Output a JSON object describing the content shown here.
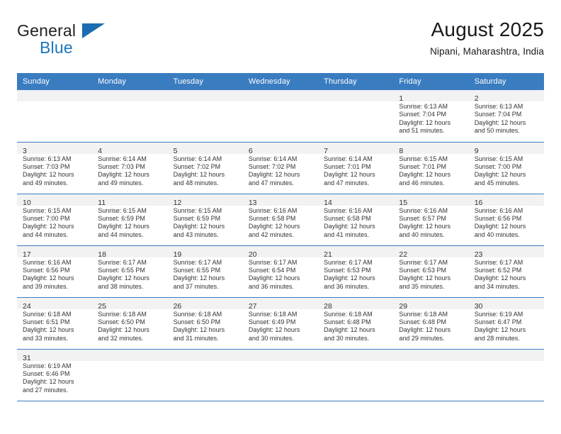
{
  "brand": {
    "name_part1": "General",
    "name_part2": "Blue",
    "flag_color": "#1b6cb0"
  },
  "header": {
    "title": "August 2025",
    "subtitle": "Nipani, Maharashtra, India"
  },
  "theme": {
    "header_bg": "#3a7cc0",
    "daynum_bg": "#f2f2f2",
    "grid_line": "#3a7cc0",
    "text": "#333333"
  },
  "weekdays": [
    "Sunday",
    "Monday",
    "Tuesday",
    "Wednesday",
    "Thursday",
    "Friday",
    "Saturday"
  ],
  "weeks": [
    [
      {
        "day": "",
        "sunrise": "",
        "sunset": "",
        "daylight1": "",
        "daylight2": ""
      },
      {
        "day": "",
        "sunrise": "",
        "sunset": "",
        "daylight1": "",
        "daylight2": ""
      },
      {
        "day": "",
        "sunrise": "",
        "sunset": "",
        "daylight1": "",
        "daylight2": ""
      },
      {
        "day": "",
        "sunrise": "",
        "sunset": "",
        "daylight1": "",
        "daylight2": ""
      },
      {
        "day": "",
        "sunrise": "",
        "sunset": "",
        "daylight1": "",
        "daylight2": ""
      },
      {
        "day": "1",
        "sunrise": "Sunrise: 6:13 AM",
        "sunset": "Sunset: 7:04 PM",
        "daylight1": "Daylight: 12 hours",
        "daylight2": "and 51 minutes."
      },
      {
        "day": "2",
        "sunrise": "Sunrise: 6:13 AM",
        "sunset": "Sunset: 7:04 PM",
        "daylight1": "Daylight: 12 hours",
        "daylight2": "and 50 minutes."
      }
    ],
    [
      {
        "day": "3",
        "sunrise": "Sunrise: 6:13 AM",
        "sunset": "Sunset: 7:03 PM",
        "daylight1": "Daylight: 12 hours",
        "daylight2": "and 49 minutes."
      },
      {
        "day": "4",
        "sunrise": "Sunrise: 6:14 AM",
        "sunset": "Sunset: 7:03 PM",
        "daylight1": "Daylight: 12 hours",
        "daylight2": "and 49 minutes."
      },
      {
        "day": "5",
        "sunrise": "Sunrise: 6:14 AM",
        "sunset": "Sunset: 7:02 PM",
        "daylight1": "Daylight: 12 hours",
        "daylight2": "and 48 minutes."
      },
      {
        "day": "6",
        "sunrise": "Sunrise: 6:14 AM",
        "sunset": "Sunset: 7:02 PM",
        "daylight1": "Daylight: 12 hours",
        "daylight2": "and 47 minutes."
      },
      {
        "day": "7",
        "sunrise": "Sunrise: 6:14 AM",
        "sunset": "Sunset: 7:01 PM",
        "daylight1": "Daylight: 12 hours",
        "daylight2": "and 47 minutes."
      },
      {
        "day": "8",
        "sunrise": "Sunrise: 6:15 AM",
        "sunset": "Sunset: 7:01 PM",
        "daylight1": "Daylight: 12 hours",
        "daylight2": "and 46 minutes."
      },
      {
        "day": "9",
        "sunrise": "Sunrise: 6:15 AM",
        "sunset": "Sunset: 7:00 PM",
        "daylight1": "Daylight: 12 hours",
        "daylight2": "and 45 minutes."
      }
    ],
    [
      {
        "day": "10",
        "sunrise": "Sunrise: 6:15 AM",
        "sunset": "Sunset: 7:00 PM",
        "daylight1": "Daylight: 12 hours",
        "daylight2": "and 44 minutes."
      },
      {
        "day": "11",
        "sunrise": "Sunrise: 6:15 AM",
        "sunset": "Sunset: 6:59 PM",
        "daylight1": "Daylight: 12 hours",
        "daylight2": "and 44 minutes."
      },
      {
        "day": "12",
        "sunrise": "Sunrise: 6:15 AM",
        "sunset": "Sunset: 6:59 PM",
        "daylight1": "Daylight: 12 hours",
        "daylight2": "and 43 minutes."
      },
      {
        "day": "13",
        "sunrise": "Sunrise: 6:16 AM",
        "sunset": "Sunset: 6:58 PM",
        "daylight1": "Daylight: 12 hours",
        "daylight2": "and 42 minutes."
      },
      {
        "day": "14",
        "sunrise": "Sunrise: 6:16 AM",
        "sunset": "Sunset: 6:58 PM",
        "daylight1": "Daylight: 12 hours",
        "daylight2": "and 41 minutes."
      },
      {
        "day": "15",
        "sunrise": "Sunrise: 6:16 AM",
        "sunset": "Sunset: 6:57 PM",
        "daylight1": "Daylight: 12 hours",
        "daylight2": "and 40 minutes."
      },
      {
        "day": "16",
        "sunrise": "Sunrise: 6:16 AM",
        "sunset": "Sunset: 6:56 PM",
        "daylight1": "Daylight: 12 hours",
        "daylight2": "and 40 minutes."
      }
    ],
    [
      {
        "day": "17",
        "sunrise": "Sunrise: 6:16 AM",
        "sunset": "Sunset: 6:56 PM",
        "daylight1": "Daylight: 12 hours",
        "daylight2": "and 39 minutes."
      },
      {
        "day": "18",
        "sunrise": "Sunrise: 6:17 AM",
        "sunset": "Sunset: 6:55 PM",
        "daylight1": "Daylight: 12 hours",
        "daylight2": "and 38 minutes."
      },
      {
        "day": "19",
        "sunrise": "Sunrise: 6:17 AM",
        "sunset": "Sunset: 6:55 PM",
        "daylight1": "Daylight: 12 hours",
        "daylight2": "and 37 minutes."
      },
      {
        "day": "20",
        "sunrise": "Sunrise: 6:17 AM",
        "sunset": "Sunset: 6:54 PM",
        "daylight1": "Daylight: 12 hours",
        "daylight2": "and 36 minutes."
      },
      {
        "day": "21",
        "sunrise": "Sunrise: 6:17 AM",
        "sunset": "Sunset: 6:53 PM",
        "daylight1": "Daylight: 12 hours",
        "daylight2": "and 36 minutes."
      },
      {
        "day": "22",
        "sunrise": "Sunrise: 6:17 AM",
        "sunset": "Sunset: 6:53 PM",
        "daylight1": "Daylight: 12 hours",
        "daylight2": "and 35 minutes."
      },
      {
        "day": "23",
        "sunrise": "Sunrise: 6:17 AM",
        "sunset": "Sunset: 6:52 PM",
        "daylight1": "Daylight: 12 hours",
        "daylight2": "and 34 minutes."
      }
    ],
    [
      {
        "day": "24",
        "sunrise": "Sunrise: 6:18 AM",
        "sunset": "Sunset: 6:51 PM",
        "daylight1": "Daylight: 12 hours",
        "daylight2": "and 33 minutes."
      },
      {
        "day": "25",
        "sunrise": "Sunrise: 6:18 AM",
        "sunset": "Sunset: 6:50 PM",
        "daylight1": "Daylight: 12 hours",
        "daylight2": "and 32 minutes."
      },
      {
        "day": "26",
        "sunrise": "Sunrise: 6:18 AM",
        "sunset": "Sunset: 6:50 PM",
        "daylight1": "Daylight: 12 hours",
        "daylight2": "and 31 minutes."
      },
      {
        "day": "27",
        "sunrise": "Sunrise: 6:18 AM",
        "sunset": "Sunset: 6:49 PM",
        "daylight1": "Daylight: 12 hours",
        "daylight2": "and 30 minutes."
      },
      {
        "day": "28",
        "sunrise": "Sunrise: 6:18 AM",
        "sunset": "Sunset: 6:48 PM",
        "daylight1": "Daylight: 12 hours",
        "daylight2": "and 30 minutes."
      },
      {
        "day": "29",
        "sunrise": "Sunrise: 6:18 AM",
        "sunset": "Sunset: 6:48 PM",
        "daylight1": "Daylight: 12 hours",
        "daylight2": "and 29 minutes."
      },
      {
        "day": "30",
        "sunrise": "Sunrise: 6:19 AM",
        "sunset": "Sunset: 6:47 PM",
        "daylight1": "Daylight: 12 hours",
        "daylight2": "and 28 minutes."
      }
    ],
    [
      {
        "day": "31",
        "sunrise": "Sunrise: 6:19 AM",
        "sunset": "Sunset: 6:46 PM",
        "daylight1": "Daylight: 12 hours",
        "daylight2": "and 27 minutes."
      },
      {
        "day": "",
        "sunrise": "",
        "sunset": "",
        "daylight1": "",
        "daylight2": ""
      },
      {
        "day": "",
        "sunrise": "",
        "sunset": "",
        "daylight1": "",
        "daylight2": ""
      },
      {
        "day": "",
        "sunrise": "",
        "sunset": "",
        "daylight1": "",
        "daylight2": ""
      },
      {
        "day": "",
        "sunrise": "",
        "sunset": "",
        "daylight1": "",
        "daylight2": ""
      },
      {
        "day": "",
        "sunrise": "",
        "sunset": "",
        "daylight1": "",
        "daylight2": ""
      },
      {
        "day": "",
        "sunrise": "",
        "sunset": "",
        "daylight1": "",
        "daylight2": ""
      }
    ]
  ]
}
